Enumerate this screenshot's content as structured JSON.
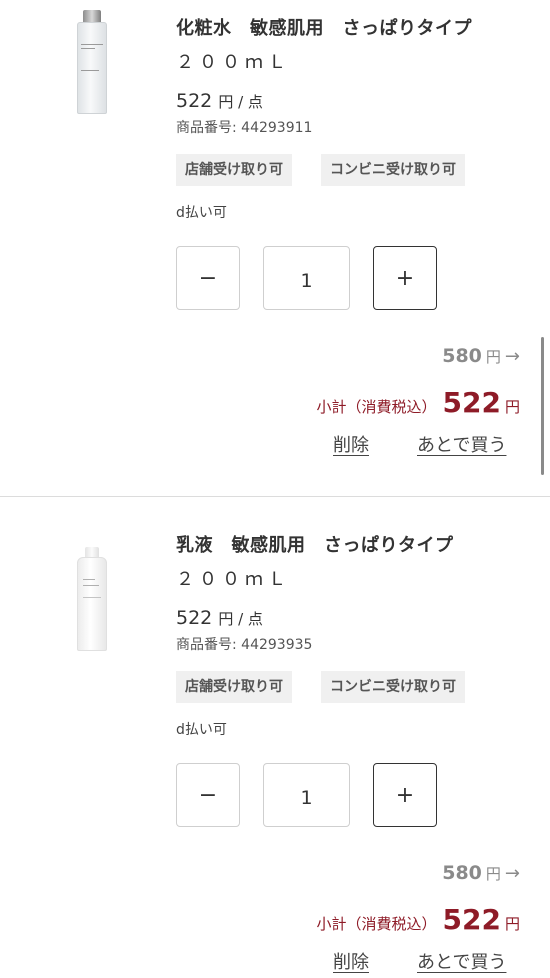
{
  "items": [
    {
      "name": "化粧水　敏感肌用　さっぱりタイプ",
      "size": "２００ｍＬ",
      "price": "522",
      "price_unit": "円 / 点",
      "product_code": "商品番号: 44293911",
      "tags": [
        "店舗受け取り可",
        "コンビニ受け取り可"
      ],
      "payment_note": "d払い可",
      "quantity": "1",
      "minus_label": "−",
      "plus_label": "+",
      "original_price": "580",
      "original_yen": "円",
      "arrow": "→",
      "subtotal_label": "小計（消費税込）",
      "subtotal_value": "522",
      "subtotal_yen": "円",
      "delete_label": "削除",
      "save_later_label": "あとで買う"
    },
    {
      "name": "乳液　敏感肌用　さっぱりタイプ",
      "size": "２００ｍＬ",
      "price": "522",
      "price_unit": "円 / 点",
      "product_code": "商品番号: 44293935",
      "tags": [
        "店舗受け取り可",
        "コンビニ受け取り可"
      ],
      "payment_note": "d払い可",
      "quantity": "1",
      "minus_label": "−",
      "plus_label": "+",
      "original_price": "580",
      "original_yen": "円",
      "arrow": "→",
      "subtotal_label": "小計（消費税込）",
      "subtotal_value": "522",
      "subtotal_yen": "円",
      "delete_label": "削除",
      "save_later_label": "あとで買う"
    }
  ],
  "colors": {
    "accent": "#8e1b27",
    "tag_bg": "#f0f0f0",
    "text": "#333333",
    "muted": "#8a8a8a"
  },
  "icons": {
    "product_image_1": "toner-bottle-image",
    "product_image_2": "lotion-bottle-image",
    "arrow": "arrow-right-icon"
  }
}
